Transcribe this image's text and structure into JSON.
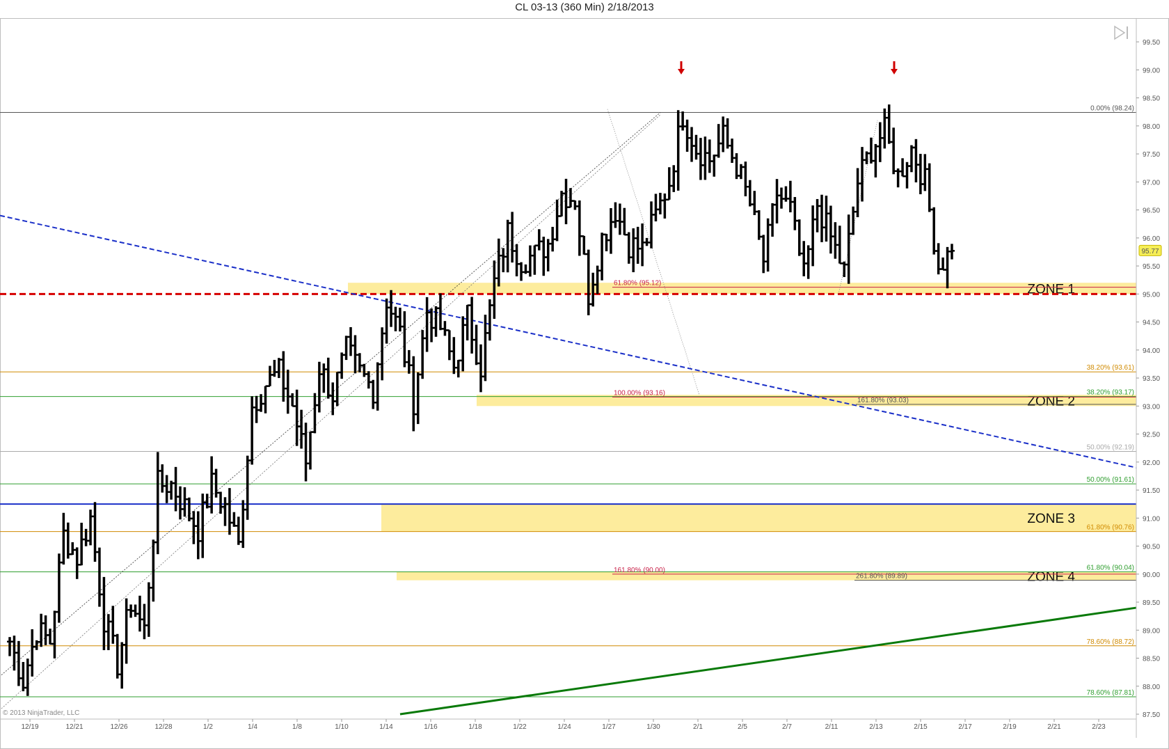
{
  "title": "CL 03-13 (360 Min)  2/18/2013",
  "copyright": "© 2013 NinjaTrader, LLC",
  "last_price": "95.77",
  "colors": {
    "bars": "#000000",
    "last_price_tag": "#f6ee56",
    "zone_fill": "#fde98c",
    "support_line": "#d60000",
    "falling_trend": "#1a2fc8",
    "resistance_line": "#1a2fc8",
    "rising_trend": "#0a7a0a",
    "fib_green": "#2f9e2f",
    "fib_orange": "#d08a00",
    "fib_red": "#c81e46"
  },
  "chart_data": {
    "type": "ohlc-bar",
    "title": "CL 03-13 (360 Min)  2/18/2013",
    "ylim": [
      87.5,
      99.75
    ],
    "y_ticks": [
      "87.50",
      "88.00",
      "88.50",
      "89.00",
      "89.50",
      "90.00",
      "90.50",
      "91.00",
      "91.50",
      "92.00",
      "92.50",
      "93.00",
      "93.50",
      "94.00",
      "94.50",
      "95.00",
      "95.50",
      "96.00",
      "96.50",
      "97.00",
      "97.50",
      "98.00",
      "98.50",
      "99.00",
      "99.50"
    ],
    "x_labels": [
      "12/19",
      "12/21",
      "12/26",
      "12/28",
      "1/2",
      "1/4",
      "1/8",
      "1/10",
      "1/14",
      "1/16",
      "1/18",
      "1/22",
      "1/24",
      "1/27",
      "1/30",
      "2/1",
      "2/5",
      "2/7",
      "2/11",
      "2/13",
      "2/15",
      "2/17",
      "2/19",
      "2/21",
      "2/23"
    ],
    "last_price": 95.77,
    "price_path": [
      88.8,
      88.1,
      89.0,
      88.8,
      90.7,
      90.3,
      91.0,
      89.2,
      88.4,
      89.5,
      89.0,
      91.6,
      91.6,
      91.2,
      90.8,
      91.6,
      91.2,
      90.5,
      93.0,
      93.4,
      93.6,
      93.0,
      92.0,
      93.7,
      93.2,
      94.0,
      93.6,
      93.3,
      94.9,
      94.3,
      93.1,
      94.7,
      94.4,
      93.7,
      94.6,
      93.7,
      95.2,
      96.1,
      95.6,
      95.7,
      95.9,
      96.8,
      96.7,
      95.0,
      96.0,
      96.5,
      95.9,
      95.8,
      96.4,
      97.0,
      98.2,
      97.6,
      97.4,
      97.8,
      97.3,
      96.6,
      95.6,
      96.8,
      96.5,
      95.3,
      96.6,
      96.0,
      95.4,
      97.0,
      97.6,
      97.9,
      97.1,
      97.6,
      97.0,
      95.5,
      95.77
    ],
    "fib_levels_right": [
      {
        "label": "0.00% (98.24)",
        "value": 98.24,
        "color": "#555555"
      },
      {
        "label": "38.20% (93.61)",
        "value": 93.61,
        "color": "#d08a00"
      },
      {
        "label": "38.20% (93.17)",
        "value": 93.17,
        "color": "#2f9e2f"
      },
      {
        "label": "50.00% (92.19)",
        "value": 92.19,
        "color": "#aaaaaa"
      },
      {
        "label": "50.00% (91.61)",
        "value": 91.61,
        "color": "#2f9e2f"
      },
      {
        "label": "61.80% (90.76)",
        "value": 90.76,
        "color": "#d08a00"
      },
      {
        "label": "61.80% (90.04)",
        "value": 90.04,
        "color": "#2f9e2f"
      },
      {
        "label": "78.60% (88.72)",
        "value": 88.72,
        "color": "#d08a00"
      },
      {
        "label": "78.60% (87.81)",
        "value": 87.81,
        "color": "#2f9e2f"
      }
    ],
    "fib_levels_inline": [
      {
        "label": "61.80% (95.12)",
        "value": 95.12,
        "color": "#c81e46"
      },
      {
        "label": "100.00% (93.16)",
        "value": 93.16,
        "color": "#c81e46"
      },
      {
        "label": "161.80% (93.03)",
        "value": 93.03,
        "color": "#555555"
      },
      {
        "label": "161.80% (90.00)",
        "value": 90.0,
        "color": "#c81e46"
      },
      {
        "label": "261.80% (89.89)",
        "value": 89.89,
        "color": "#555555"
      }
    ],
    "zones": [
      {
        "label": "ZONE 1",
        "from": 95.0,
        "to": 95.2
      },
      {
        "label": "ZONE 2",
        "from": 93.0,
        "to": 93.2
      },
      {
        "label": "ZONE 3",
        "from": 90.76,
        "to": 91.25
      },
      {
        "label": "ZONE 4",
        "from": 89.89,
        "to": 90.04
      }
    ],
    "support_line": 95.0,
    "resistance_line": 91.25,
    "falling_trendline": {
      "from": {
        "x": "12/19",
        "y": 96.4
      },
      "to": {
        "x": "2/23",
        "y": 91.9
      }
    },
    "rising_trendline": {
      "from": {
        "x": "1/14",
        "y": 87.5
      },
      "to": {
        "x": "2/23",
        "y": 89.4
      }
    },
    "top_markers": [
      {
        "x": "1/30",
        "label": "down-arrow"
      },
      {
        "x": "2/13",
        "label": "down-arrow"
      }
    ]
  }
}
